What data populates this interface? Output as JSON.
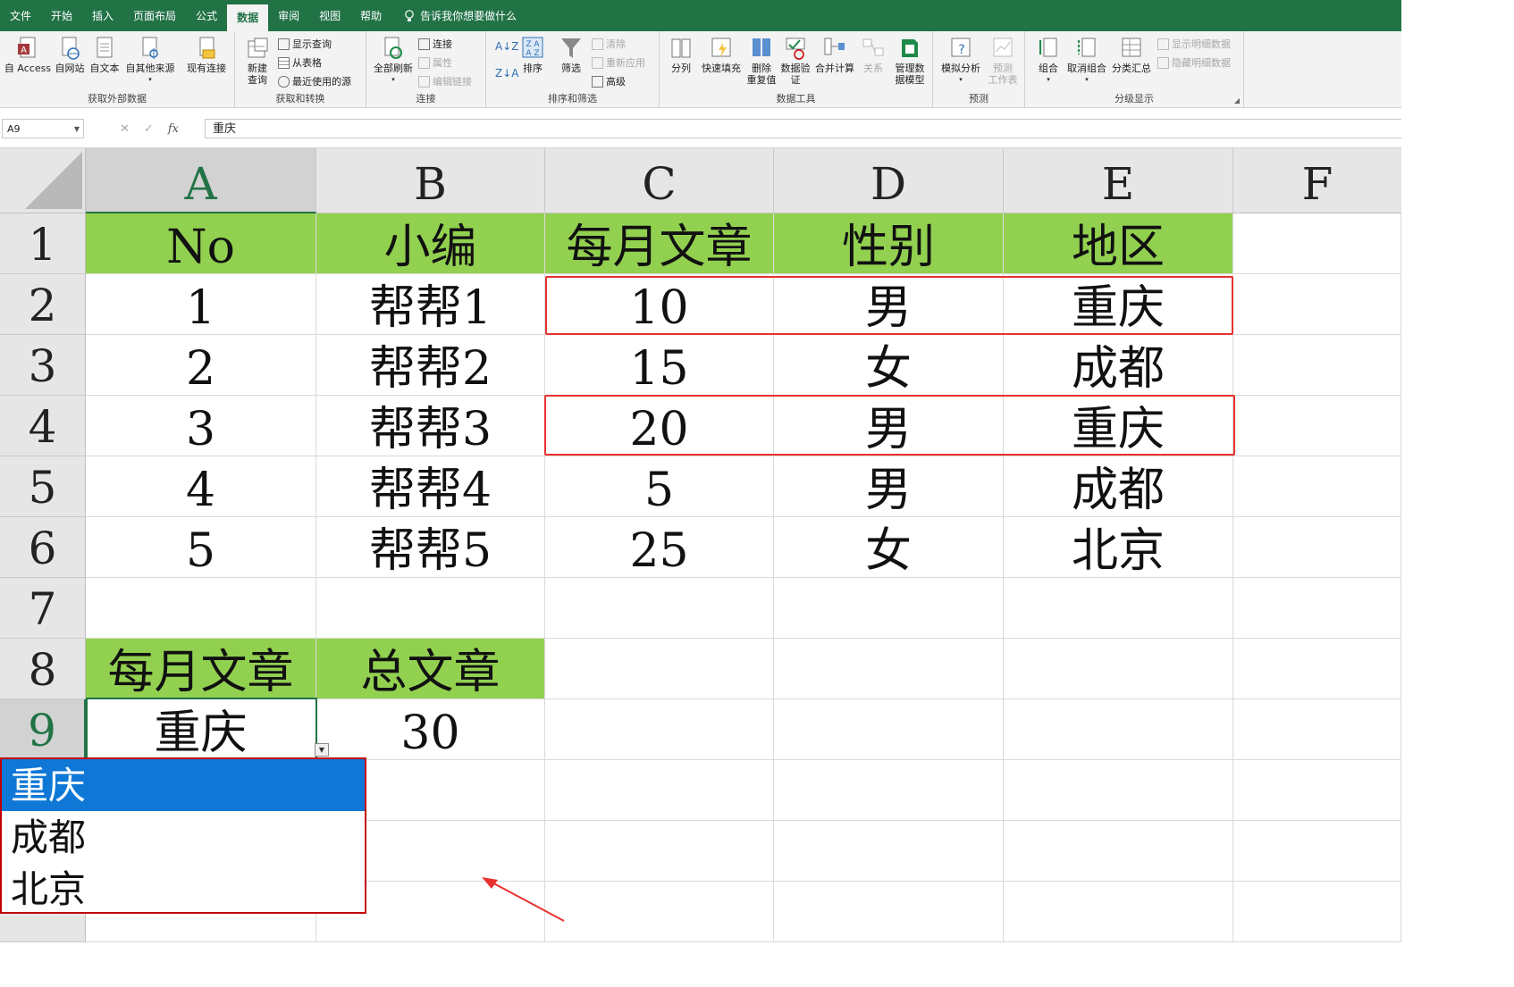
{
  "tabs": [
    "文件",
    "开始",
    "插入",
    "页面布局",
    "公式",
    "数据",
    "审阅",
    "视图",
    "帮助"
  ],
  "active_tab": "数据",
  "tell_me": "告诉我你想要做什么",
  "ribbon": {
    "get_external": {
      "label": "获取外部数据",
      "access": "自 Access",
      "web": "自网站",
      "text": "自文本",
      "other": "自其他来源",
      "existing": "现有连接"
    },
    "get_transform": {
      "label": "获取和转换",
      "new_query": "新建\n查询",
      "show_query": "显示查询",
      "from_table": "从表格",
      "recent": "最近使用的源"
    },
    "connections": {
      "label": "连接",
      "refresh_all": "全部刷新",
      "connections": "连接",
      "properties": "属性",
      "edit_links": "编辑链接"
    },
    "sort_filter": {
      "label": "排序和筛选",
      "sort": "排序",
      "filter": "筛选",
      "clear": "清除",
      "reapply": "重新应用",
      "advanced": "高级"
    },
    "data_tools": {
      "label": "数据工具",
      "split": "分列",
      "flash_fill": "快速填充",
      "remove_dup": "删除\n重复值",
      "validation": "数据验\n证",
      "consolidate": "合并计算",
      "relationships": "关系",
      "data_model": "管理数\n据模型"
    },
    "forecast": {
      "label": "预测",
      "what_if": "模拟分析",
      "forecast_sheet": "预测\n工作表"
    },
    "outline": {
      "label": "分级显示",
      "group": "组合",
      "ungroup": "取消组合",
      "subtotal": "分类汇总",
      "show_detail": "显示明细数据",
      "hide_detail": "隐藏明细数据"
    }
  },
  "name_box": "A9",
  "formula": "重庆",
  "columns": [
    "A",
    "B",
    "C",
    "D",
    "E",
    "F"
  ],
  "rows": [
    "1",
    "2",
    "3",
    "4",
    "5",
    "6",
    "7",
    "8",
    "9"
  ],
  "header_row": [
    "No",
    "小编",
    "每月文章",
    "性别",
    "地区"
  ],
  "table": [
    [
      "1",
      "帮帮1",
      "10",
      "男",
      "重庆"
    ],
    [
      "2",
      "帮帮2",
      "15",
      "女",
      "成都"
    ],
    [
      "3",
      "帮帮3",
      "20",
      "男",
      "重庆"
    ],
    [
      "4",
      "帮帮4",
      "5",
      "男",
      "成都"
    ],
    [
      "5",
      "帮帮5",
      "25",
      "女",
      "北京"
    ]
  ],
  "summary_headers": [
    "每月文章",
    "总文章"
  ],
  "summary_values": [
    "重庆",
    "30"
  ],
  "dropdown_options": [
    "重庆",
    "成都",
    "北京"
  ],
  "dropdown_selected": "重庆",
  "colors": {
    "green_header": "#92d050",
    "excel_green": "#217346",
    "highlight": "#e8322f",
    "dropdown_select": "#0f78d7"
  }
}
